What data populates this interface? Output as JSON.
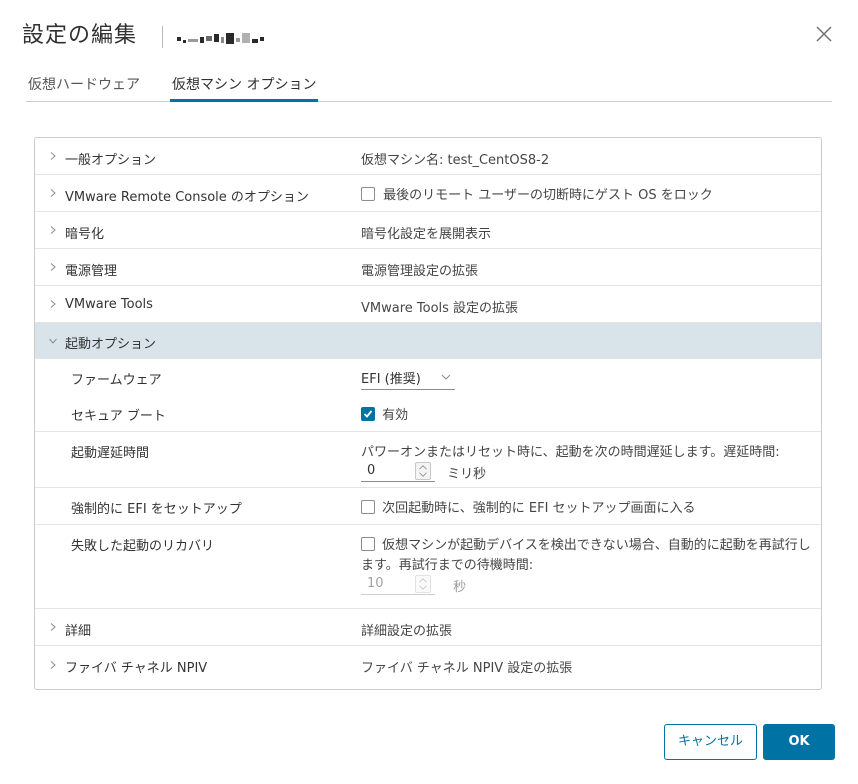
{
  "dialog": {
    "title": "設定の編集"
  },
  "tabs": [
    {
      "label": "仮想ハードウェア",
      "active": false
    },
    {
      "label": "仮想マシン オプション",
      "active": true
    }
  ],
  "rows": {
    "general": {
      "label": "一般オプション",
      "value": "仮想マシン名: test_CentOS8-2"
    },
    "vmrc": {
      "label": "VMware Remote Console のオプション",
      "value": "最後のリモート ユーザーの切断時にゲスト OS をロック"
    },
    "encryption": {
      "label": "暗号化",
      "value": "暗号化設定を展開表示"
    },
    "power": {
      "label": "電源管理",
      "value": "電源管理設定の拡張"
    },
    "tools": {
      "label": "VMware Tools",
      "value": "VMware Tools 設定の拡張"
    },
    "boot": {
      "label": "起動オプション"
    },
    "firmware": {
      "label": "ファームウェア",
      "value": "EFI (推奨)"
    },
    "secure_boot": {
      "label": "セキュア ブート",
      "value": "有効",
      "checked": true
    },
    "boot_delay": {
      "label": "起動遅延時間",
      "desc": "パワーオンまたはリセット時に、起動を次の時間遅延します。遅延時間:",
      "value": "0",
      "unit": "ミリ秒"
    },
    "force_efi": {
      "label": "強制的に EFI をセットアップ",
      "value": "次回起動時に、強制的に EFI セットアップ画面に入る",
      "checked": false
    },
    "failed_boot": {
      "label": "失敗した起動のリカバリ",
      "desc_line1": "仮想マシンが起動デバイスを検出できない場合、自動的に起動を再試行し",
      "desc_line2": "ます。再試行までの待機時間:",
      "value": "10",
      "unit": "秒",
      "checked": false
    },
    "advanced": {
      "label": "詳細",
      "value": "詳細設定の拡張"
    },
    "npiv": {
      "label": "ファイバ チャネル NPIV",
      "value": "ファイバ チャネル NPIV 設定の拡張"
    }
  },
  "buttons": {
    "cancel": "キャンセル",
    "ok": "OK"
  },
  "colors": {
    "accent": "#0072a3",
    "expanded_row": "#d9e4ea"
  }
}
